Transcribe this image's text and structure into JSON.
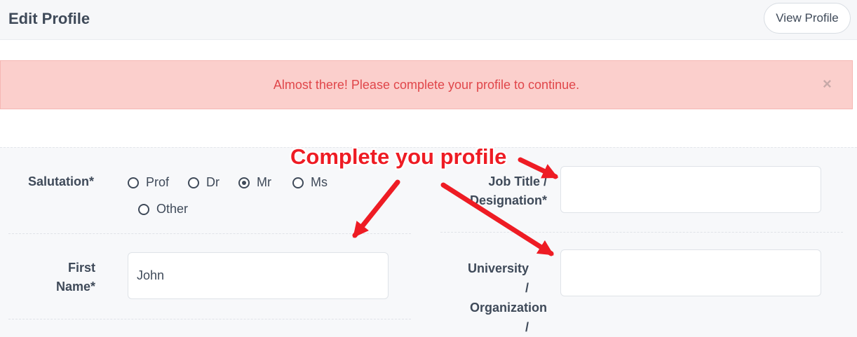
{
  "header": {
    "title": "Edit Profile",
    "view_profile_label": "View Profile"
  },
  "alert": {
    "message": "Almost there! Please complete your profile to continue.",
    "close_glyph": "×"
  },
  "annotation": {
    "text": "Complete you profile",
    "color": "#ee1c24"
  },
  "form": {
    "salutation": {
      "label": "Salutation*",
      "options": [
        {
          "label": "Prof",
          "checked": false
        },
        {
          "label": "Dr",
          "checked": false
        },
        {
          "label": "Mr",
          "checked": true
        },
        {
          "label": "Ms",
          "checked": false
        },
        {
          "label": "Other",
          "checked": false
        }
      ]
    },
    "first_name": {
      "label_line1": "First",
      "label_line2": "Name*",
      "value": "John"
    },
    "job_title": {
      "label_line1": "Job Title /",
      "label_line2": "Designation*",
      "value": ""
    },
    "organization": {
      "label_line1": "University",
      "label_line2": "/",
      "label_line3": "Organization",
      "label_line4": "/",
      "value": ""
    }
  },
  "colors": {
    "alert_bg": "#fbcfcc",
    "alert_text": "#e0464a",
    "text": "#3f4a59"
  }
}
